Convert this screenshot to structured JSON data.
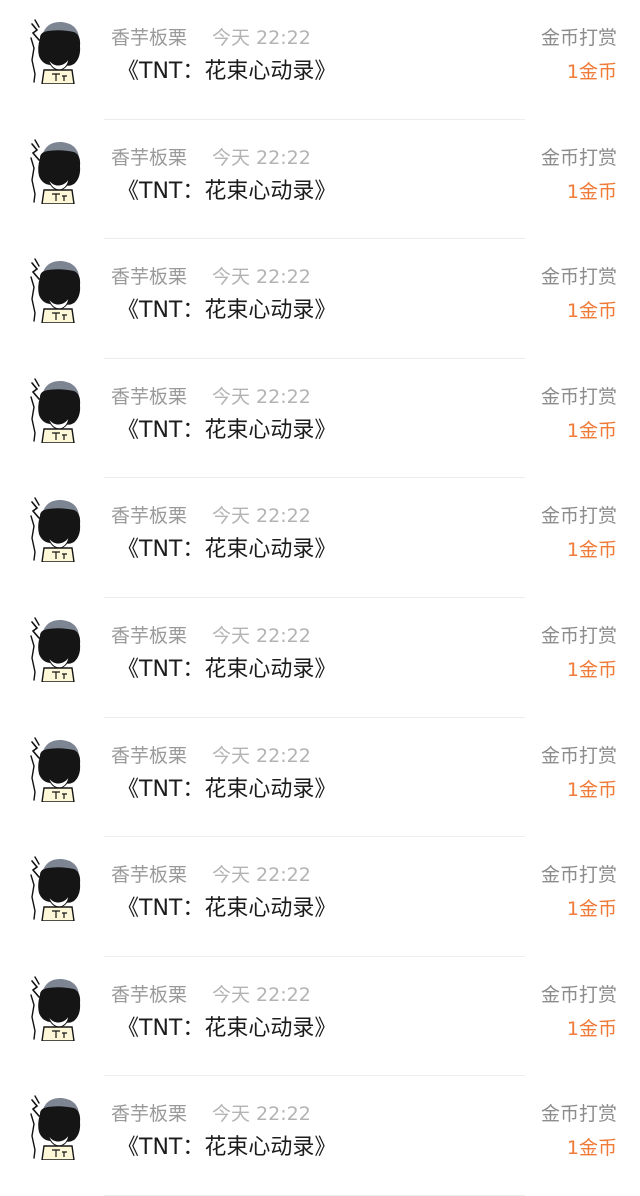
{
  "reward_list": {
    "items": [
      {
        "username": "香芋板栗",
        "time": "今天 22:22",
        "title": "《TNT：花束心动录》",
        "action": "金币打赏",
        "amount": "1金币"
      },
      {
        "username": "香芋板栗",
        "time": "今天 22:22",
        "title": "《TNT：花束心动录》",
        "action": "金币打赏",
        "amount": "1金币"
      },
      {
        "username": "香芋板栗",
        "time": "今天 22:22",
        "title": "《TNT：花束心动录》",
        "action": "金币打赏",
        "amount": "1金币"
      },
      {
        "username": "香芋板栗",
        "time": "今天 22:22",
        "title": "《TNT：花束心动录》",
        "action": "金币打赏",
        "amount": "1金币"
      },
      {
        "username": "香芋板栗",
        "time": "今天 22:22",
        "title": "《TNT：花束心动录》",
        "action": "金币打赏",
        "amount": "1金币"
      },
      {
        "username": "香芋板栗",
        "time": "今天 22:22",
        "title": "《TNT：花束心动录》",
        "action": "金币打赏",
        "amount": "1金币"
      },
      {
        "username": "香芋板栗",
        "time": "今天 22:22",
        "title": "《TNT：花束心动录》",
        "action": "金币打赏",
        "amount": "1金币"
      },
      {
        "username": "香芋板栗",
        "time": "今天 22:22",
        "title": "《TNT：花束心动录》",
        "action": "金币打赏",
        "amount": "1金币"
      },
      {
        "username": "香芋板栗",
        "time": "今天 22:22",
        "title": "《TNT：花束心动录》",
        "action": "金币打赏",
        "amount": "1金币"
      },
      {
        "username": "香芋板栗",
        "time": "今天 22:22",
        "title": "《TNT：花束心动录》",
        "action": "金币打赏",
        "amount": "1金币"
      }
    ]
  },
  "colors": {
    "amount": "#f07a38",
    "username": "#9a9a9a",
    "time": "#b3b3b3",
    "title": "#1c1c1c",
    "action": "#8c8c8c",
    "divider": "#ededed"
  },
  "icons": {
    "avatar": "cartoon-avatar-icon"
  }
}
